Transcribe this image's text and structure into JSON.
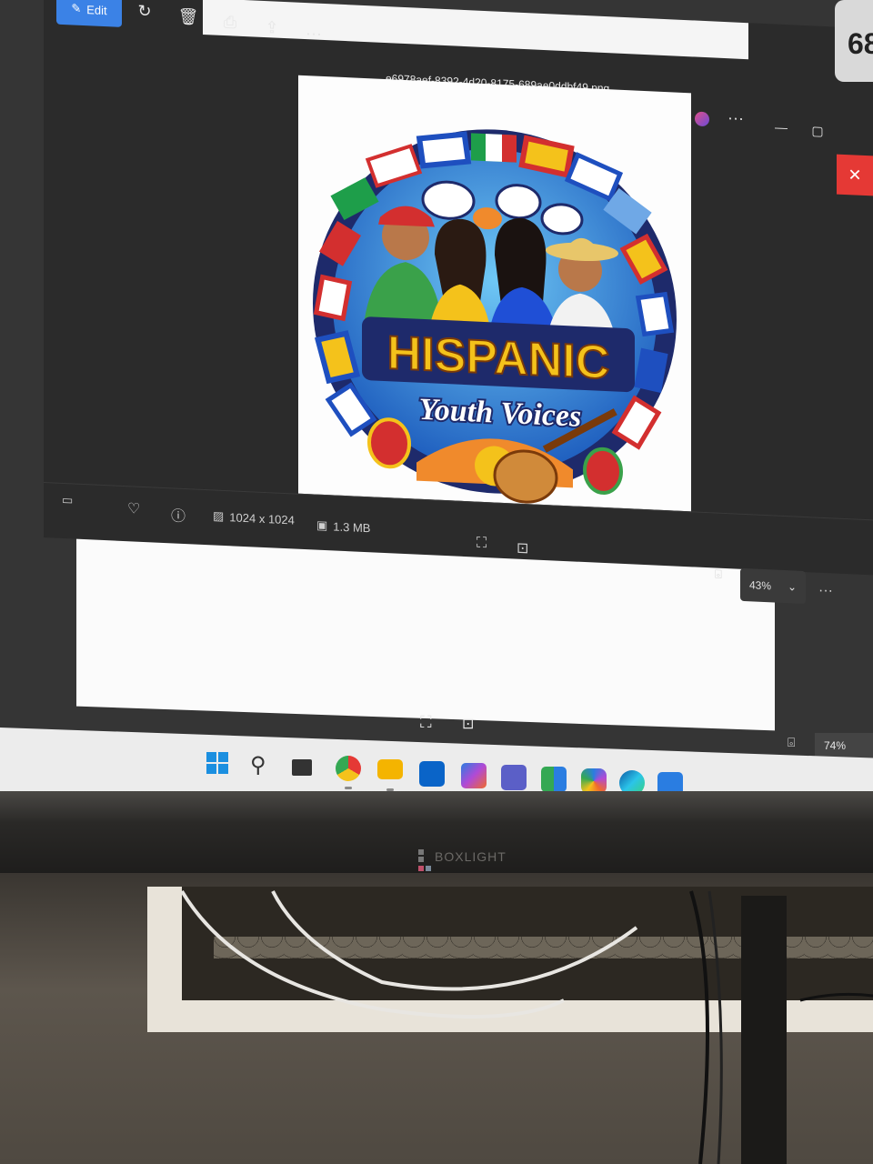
{
  "viewer": {
    "edit_label": "Edit",
    "file_name": "e6978aef-8392-4d20-8175-689ae0ddbf49.png",
    "close_glyph": "✕",
    "more_glyph": "···",
    "dimensions": "1024 x 1024",
    "file_size": "1.3 MB",
    "zoom": "43%",
    "badge_text": "68"
  },
  "artwork": {
    "title": "HISPANIC",
    "subtitle": "Youth Voices"
  },
  "back_viewer": {
    "zoom": "74%"
  },
  "taskbar": {
    "icons": [
      "windows-start-icon",
      "search-icon",
      "task-view-icon",
      "chrome-icon",
      "file-explorer-icon",
      "outlook-icon",
      "m365-icon",
      "teams-icon",
      "app-icon",
      "copilot-icon",
      "edge-icon",
      "photos-icon"
    ]
  },
  "monitor": {
    "brand": "BOXLIGHT"
  },
  "colors": {
    "accent_blue": "#3b82e6",
    "close_red": "#e53935",
    "art_gold": "#f4c21b",
    "art_navy": "#1e2a6b"
  }
}
